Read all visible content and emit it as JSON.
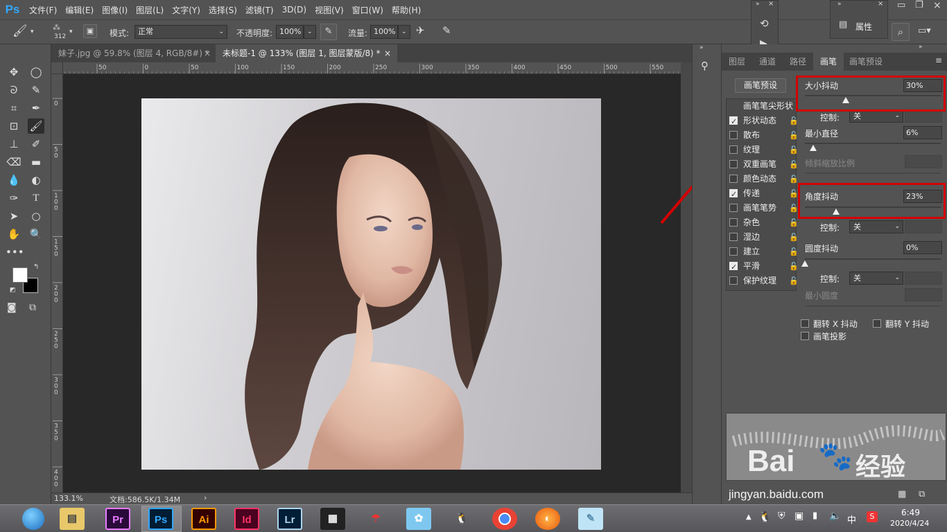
{
  "app": {
    "logo": "Ps"
  },
  "menu": [
    "文件(F)",
    "编辑(E)",
    "图像(I)",
    "图层(L)",
    "文字(Y)",
    "选择(S)",
    "滤镜(T)",
    "3D(D)",
    "视图(V)",
    "窗口(W)",
    "帮助(H)"
  ],
  "options": {
    "brush_size": "312",
    "mode_label": "模式:",
    "mode_value": "正常",
    "opacity_label": "不透明度:",
    "opacity_value": "100%",
    "flow_label": "流量:",
    "flow_value": "100%"
  },
  "float_panel": {
    "properties_label": "属性"
  },
  "tabs": [
    {
      "label": "妹子.jpg @ 59.8% (图层 4, RGB/8#) *",
      "active": false
    },
    {
      "label": "未标题-1 @ 133% (图层 1, 图层蒙版/8) *",
      "active": true
    }
  ],
  "close_glyph": "×",
  "ruler_top": [
    "50",
    "0",
    "50",
    "100",
    "150",
    "200",
    "250",
    "300",
    "350",
    "400",
    "450",
    "500",
    "550"
  ],
  "ruler_left": [
    "0",
    "5 0",
    "1 0 0",
    "1 5 0",
    "2 0 0",
    "2 5 0",
    "3 0 0",
    "3 5 0",
    "4 0 0"
  ],
  "status": {
    "zoom": "133.1%",
    "doc": "文档:586.5K/1.34M",
    "arrow": "›"
  },
  "panel": {
    "tabs": [
      "图层",
      "通道",
      "路径",
      "画笔",
      "画笔预设"
    ],
    "active_tab": "画笔",
    "preset_button": "画笔预设",
    "tip_shape": "画笔笔尖形状",
    "options": [
      {
        "label": "形状动态",
        "checked": true
      },
      {
        "label": "散布",
        "checked": false
      },
      {
        "label": "纹理",
        "checked": false
      },
      {
        "label": "双重画笔",
        "checked": false
      },
      {
        "label": "颜色动态",
        "checked": false
      },
      {
        "label": "传递",
        "checked": true
      },
      {
        "label": "画笔笔势",
        "checked": false
      },
      {
        "label": "杂色",
        "checked": false
      },
      {
        "label": "湿边",
        "checked": false
      },
      {
        "label": "建立",
        "checked": false
      },
      {
        "label": "平滑",
        "checked": true
      },
      {
        "label": "保护纹理",
        "checked": false
      }
    ],
    "size_jitter": {
      "label": "大小抖动",
      "value": "30%",
      "level": 0.3
    },
    "control_label": "控制:",
    "control_value": "关",
    "min_diameter": {
      "label": "最小直径",
      "value": "6%",
      "level": 0.06
    },
    "tilt_scale": {
      "label": "倾斜缩放比例"
    },
    "angle_jitter": {
      "label": "角度抖动",
      "value": "23%",
      "level": 0.23
    },
    "roundness_jitter": {
      "label": "圆度抖动",
      "value": "0%",
      "level": 0.0
    },
    "min_roundness": {
      "label": "最小圆度"
    },
    "flip_x": "翻转 X 抖动",
    "flip_y": "翻转 Y 抖动",
    "brush_projection": "画笔投影"
  },
  "watermark": {
    "brand": "Bai",
    "brand2": "经验",
    "url": "jingyan.baidu.com"
  },
  "taskbar": {
    "apps": [
      "Pr",
      "Ps",
      "Ai",
      "Id",
      "Lr"
    ],
    "tray_ime": "中",
    "time": "6:49",
    "date": "2020/4/24"
  },
  "colors": {
    "accent_red": "#d40000",
    "ps_blue": "#31a8ff"
  }
}
